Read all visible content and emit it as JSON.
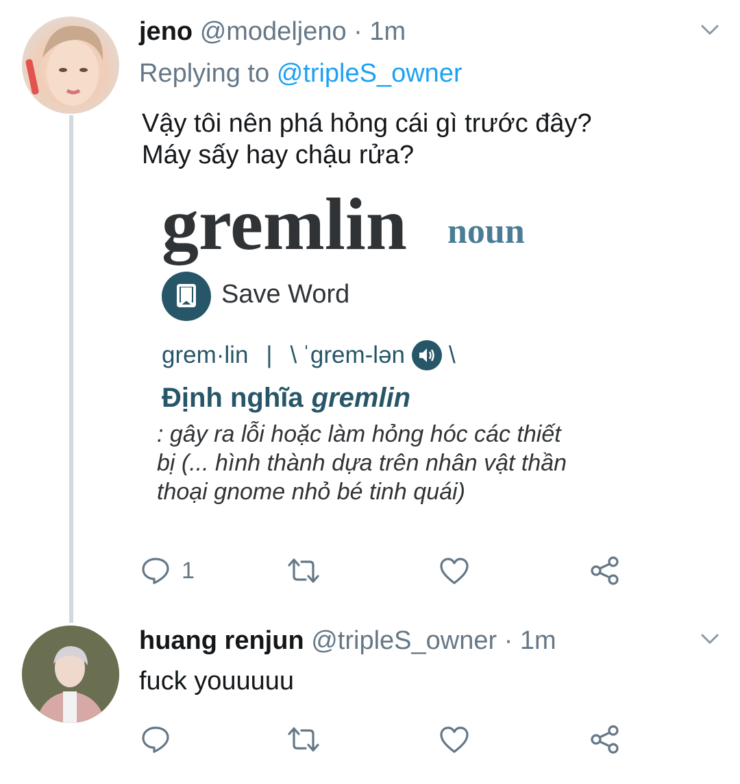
{
  "tweet1": {
    "name": "jeno",
    "handle": "@modeljeno",
    "separator": "·",
    "time": "1m",
    "replying_prefix": "Replying to",
    "replying_to": "@tripleS_owner",
    "text_lines": [
      "Vậy tôi nên phá hỏng cái gì trước đây?",
      "Máy sấy hay chậu rửa?"
    ],
    "reply_count": "1"
  },
  "media": {
    "word": "gremlin",
    "part_of_speech": "noun",
    "save_label": "Save Word",
    "syllables": "grem·lin",
    "pron_bar": "|",
    "pron_open": "\\",
    "pronunciation": "ˈgrem-lən",
    "pron_close": "\\",
    "definition_prefix": "Định nghĩa",
    "definition_word": "gremlin",
    "definition_lines": [
      ": gây ra lỗi hoặc làm hỏng hóc các thiết",
      "bị (... hình thành dựa trên nhân vật thần",
      "thoại gnome nhỏ bé tinh quái)"
    ]
  },
  "tweet2": {
    "name": "huang renjun",
    "handle": "@tripleS_owner",
    "separator": "·",
    "time": "1m",
    "text": "fuck youuuuu"
  },
  "icons": {
    "reply": "reply-icon",
    "retweet": "retweet-icon",
    "like": "heart-icon",
    "share": "share-icon",
    "more": "chevron-down-icon",
    "bookmark": "bookmark-icon",
    "speaker": "speaker-icon"
  },
  "colors": {
    "text": "#14171a",
    "secondary": "#657786",
    "link": "#1da1f2",
    "thread_line": "#cfd9de",
    "dict_accent": "#265667",
    "dict_pos": "#4a7d95"
  }
}
